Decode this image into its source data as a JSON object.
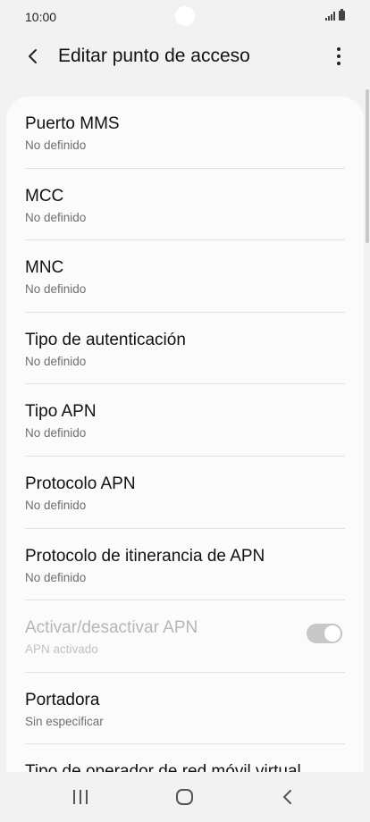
{
  "status_bar": {
    "time": "10:00",
    "icons": [
      "signal-icon",
      "battery-icon"
    ]
  },
  "app_bar": {
    "title": "Editar punto de acceso",
    "back_icon": "chevron-left-icon",
    "menu_icon": "more-vertical-icon"
  },
  "settings": [
    {
      "title": "Puerto MMS",
      "value": "No definido"
    },
    {
      "title": "MCC",
      "value": "No definido"
    },
    {
      "title": "MNC",
      "value": "No definido"
    },
    {
      "title": "Tipo de autenticación",
      "value": "No definido"
    },
    {
      "title": "Tipo APN",
      "value": "No definido"
    },
    {
      "title": "Protocolo APN",
      "value": "No definido"
    },
    {
      "title": "Protocolo de itinerancia de APN",
      "value": "No definido"
    },
    {
      "title": "Activar/desactivar APN",
      "value": "APN activado",
      "toggle": true,
      "disabled": true
    },
    {
      "title": "Portadora",
      "value": "Sin especificar"
    },
    {
      "title": "Tipo de operador de red móvil virtual",
      "value": ""
    }
  ],
  "nav_bar": {
    "icons": [
      "recents-icon",
      "home-icon",
      "back-icon"
    ]
  },
  "colors": {
    "background": "#f2f2f2",
    "card": "#fbfbfb",
    "subtext": "#6e6e6e",
    "disabled": "#b6b6b6",
    "toggle": "#c7c7c7"
  }
}
